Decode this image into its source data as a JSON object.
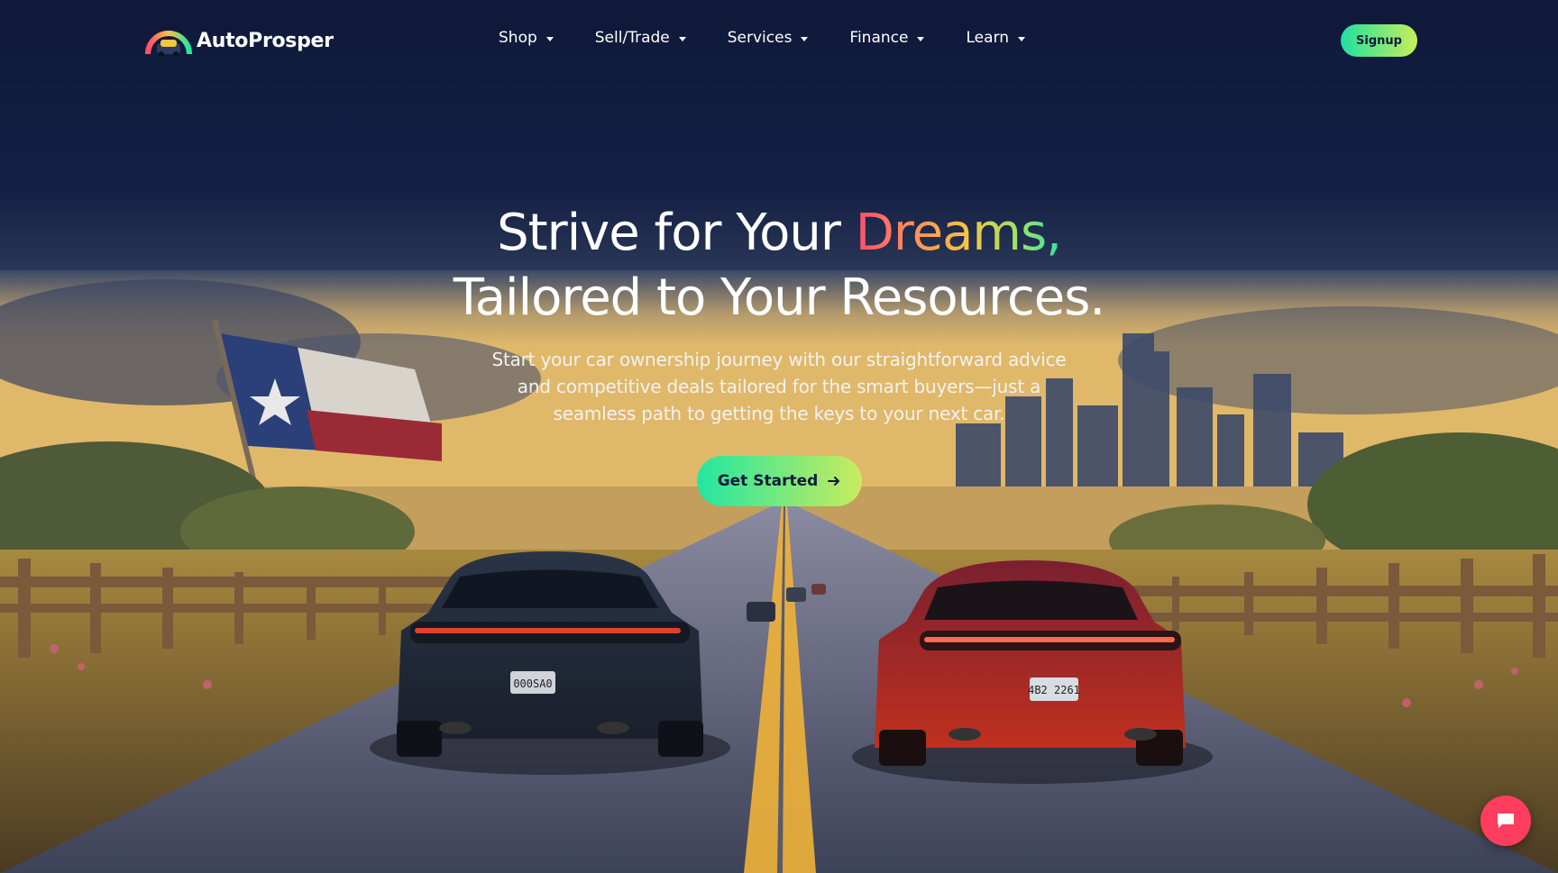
{
  "brand": {
    "name": "AutoProsper"
  },
  "nav": {
    "items": [
      {
        "label": "Shop"
      },
      {
        "label": "Sell/Trade"
      },
      {
        "label": "Services"
      },
      {
        "label": "Finance"
      },
      {
        "label": "Learn"
      }
    ],
    "signup_label": "Signup"
  },
  "hero": {
    "headline_part1": "Strive for Your ",
    "headline_highlight": "Dreams,",
    "headline_line2": "Tailored to Your Resources.",
    "subtext": "Start your car ownership journey with our straightforward advice and competitive deals tailored for the smart buyers—just a seamless path to getting the keys to your next car.",
    "cta_label": "Get Started",
    "plate_left": "000SA0",
    "plate_right": "4B2 2261"
  },
  "colors": {
    "background": "#0f1a3a",
    "cta_gradient_start": "#22e6a2",
    "cta_gradient_end": "#c9ec5d",
    "chat_button": "#ff3d5e"
  },
  "icons": {
    "caret": "chevron-down-icon",
    "cta_arrow": "arrow-right-icon",
    "chat": "chat-bubble-icon",
    "logo": "speedometer-car-logo"
  }
}
